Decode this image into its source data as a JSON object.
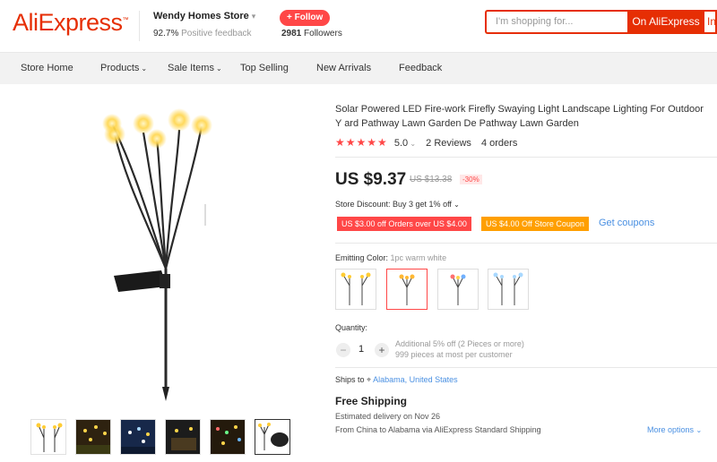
{
  "header": {
    "logo": "AliExpress",
    "store_name": "Wendy Homes Store",
    "feedback_value": "92.7%",
    "feedback_label": "Positive feedback",
    "follow_label": "+ Follow",
    "followers_count": "2981",
    "followers_label": "Followers",
    "search_placeholder": "I'm shopping for...",
    "search_button": "On AliExpress",
    "search_button2": "In"
  },
  "nav": {
    "items": [
      "Store Home",
      "Products",
      "Sale Items",
      "Top Selling",
      "New Arrivals",
      "Feedback"
    ]
  },
  "product": {
    "title": "Solar Powered LED Fire-work Firefly Swaying Light Landscape Lighting For Outdoor Y ard Pathway Lawn Garden De Pathway Lawn Garden",
    "stars": "★★★★★",
    "score": "5.0",
    "reviews": "2 Reviews",
    "orders": "4 orders",
    "price": "US $9.37",
    "old_price": "US $13.38",
    "discount": "-30%",
    "store_discount": "Store Discount: Buy 3 get 1% off",
    "coupon1": "US $3.00 off Orders over US $4.00",
    "coupon2": "US $4.00 Off Store Coupon",
    "get_coupons": "Get coupons",
    "color_label": "Emitting Color:",
    "color_value": "1pc warm white",
    "quantity_label": "Quantity:",
    "quantity_value": "1",
    "quantity_note1": "Additional 5% off (2 Pieces or more)",
    "quantity_note2": "999 pieces at most per customer",
    "ships_to_label": "Ships to",
    "ships_to_location": "Alabama, United States",
    "free_shipping": "Free Shipping",
    "estimated": "Estimated delivery on Nov 26",
    "via": "From China to Alabama via AliExpress Standard Shipping",
    "more_options": "More options"
  },
  "colors": {
    "accent": "#e62e04",
    "red": "#ff4747",
    "orange": "#ff9f00",
    "link": "#4a90e2"
  }
}
